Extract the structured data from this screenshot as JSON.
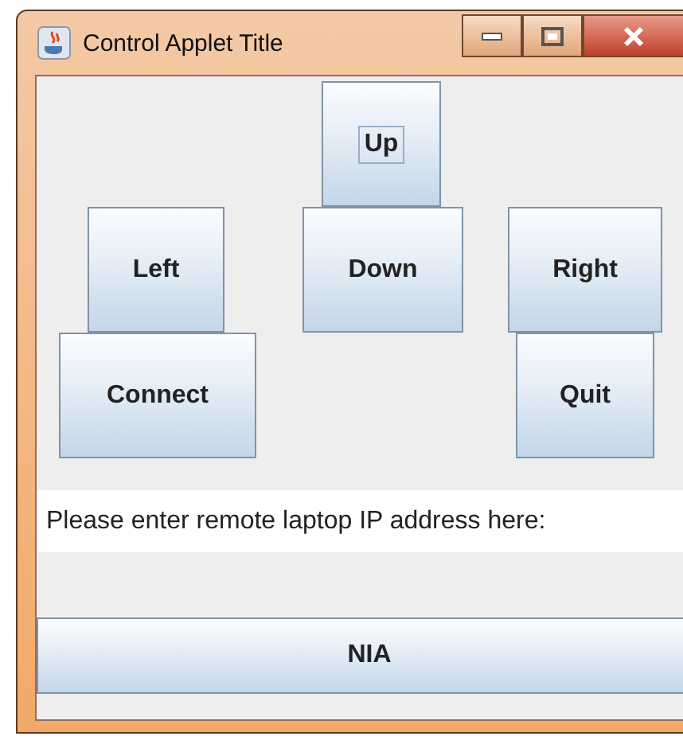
{
  "window": {
    "title": "Control Applet Title"
  },
  "pad_rows": [
    [
      {
        "label": "Up",
        "focused": true,
        "kind": "up"
      }
    ],
    [
      {
        "label": "Left",
        "focused": false,
        "kind": "left"
      },
      {
        "label": "Down",
        "focused": false,
        "kind": "down"
      },
      {
        "label": "Right",
        "focused": false,
        "kind": "right"
      }
    ],
    [
      {
        "label": "Connect",
        "focused": false,
        "kind": "connect"
      },
      {
        "label": "Quit",
        "focused": false,
        "kind": "quit"
      }
    ]
  ],
  "ip_field": {
    "value": "Please enter remote laptop IP address here:"
  },
  "bottom_button": {
    "label": "NIA"
  }
}
